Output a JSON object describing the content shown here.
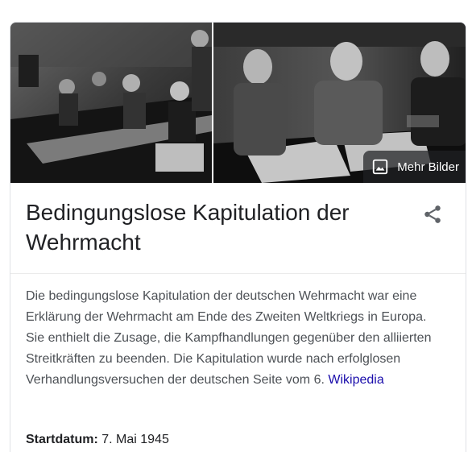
{
  "images": {
    "more_label": "Mehr Bilder",
    "more_icon": "image-icon"
  },
  "title": "Bedingungslose Kapitulation der Wehrmacht",
  "share_icon": "share-icon",
  "description": {
    "text": "Die bedingungslose Kapitulation der deutschen Wehrmacht war eine Erklärung der Wehrmacht am Ende des Zweiten Weltkriegs in Europa. Sie enthielt die Zusage, die Kampfhandlungen gegenüber den alliierten Streitkräften zu beenden. Die Kapitulation wurde nach erfolglosen Verhandlungsversuchen der deutschen Seite vom 6.",
    "source_link": "Wikipedia"
  },
  "facts": [
    {
      "label": "Startdatum:",
      "value": "7. Mai 1945"
    }
  ],
  "colors": {
    "title": "#202124",
    "text": "#4d5156",
    "link": "#1a0dab",
    "border": "#dfe1e5",
    "overlay": "#202124"
  }
}
